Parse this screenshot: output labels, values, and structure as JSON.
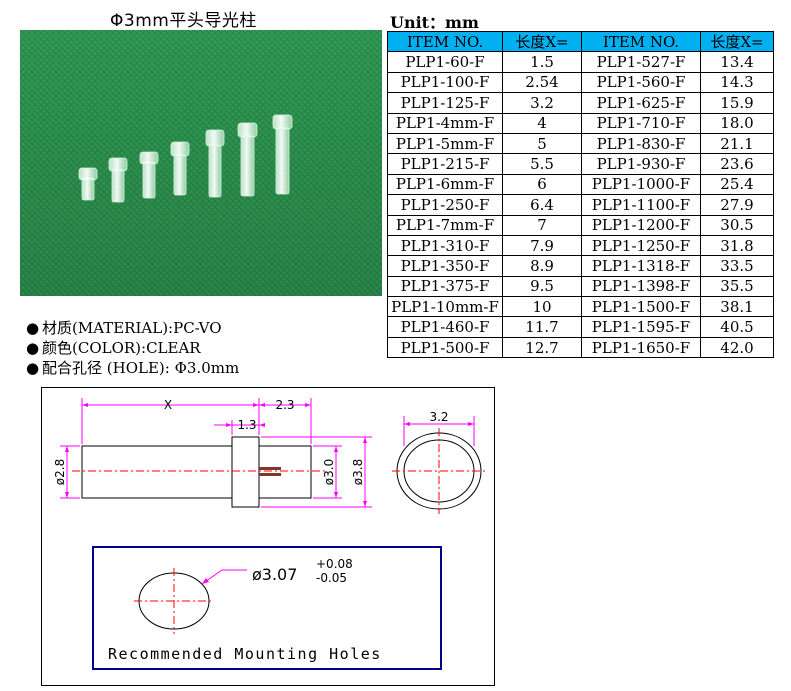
{
  "title": "Φ3mm平头导光柱",
  "unit_label": "Unit：mm",
  "table": {
    "headers": [
      "ITEM NO.",
      "长度X=",
      "ITEM NO.",
      "长度X="
    ],
    "rows": [
      [
        "PLP1-60-F",
        "1.5",
        "PLP1-527-F",
        "13.4"
      ],
      [
        "PLP1-100-F",
        "2.54",
        "PLP1-560-F",
        "14.3"
      ],
      [
        "PLP1-125-F",
        "3.2",
        "PLP1-625-F",
        "15.9"
      ],
      [
        "PLP1-4mm-F",
        "4",
        "PLP1-710-F",
        "18.0"
      ],
      [
        "PLP1-5mm-F",
        "5",
        "PLP1-830-F",
        "21.1"
      ],
      [
        "PLP1-215-F",
        "5.5",
        "PLP1-930-F",
        "23.6"
      ],
      [
        "PLP1-6mm-F",
        "6",
        "PLP1-1000-F",
        "25.4"
      ],
      [
        "PLP1-250-F",
        "6.4",
        "PLP1-1100-F",
        "27.9"
      ],
      [
        "PLP1-7mm-F",
        "7",
        "PLP1-1200-F",
        "30.5"
      ],
      [
        "PLP1-310-F",
        "7.9",
        "PLP1-1250-F",
        "31.8"
      ],
      [
        "PLP1-350-F",
        "8.9",
        "PLP1-1318-F",
        "33.5"
      ],
      [
        "PLP1-375-F",
        "9.5",
        "PLP1-1398-F",
        "35.5"
      ],
      [
        "PLP1-10mm-F",
        "10",
        "PLP1-1500-F",
        "38.1"
      ],
      [
        "PLP1-460-F",
        "11.7",
        "PLP1-1595-F",
        "40.5"
      ],
      [
        "PLP1-500-F",
        "12.7",
        "PLP1-1650-F",
        "42.0"
      ]
    ]
  },
  "properties": {
    "bullet": "●",
    "material": "材质(MATERIAL):PC-VO",
    "color": "颜色(COLOR):CLEAR",
    "hole": "配合孔径 (HOLE): Φ3.0mm"
  },
  "drawing": {
    "dim_x": "X",
    "dim_2_3": "2.3",
    "dim_1_3": "1.3",
    "dim_d2_8": "ø2.8",
    "dim_d3_0": "ø3.0",
    "dim_d3_8": "ø3.8",
    "dim_3_2": "3.2",
    "hole_dia": "ø3.07",
    "hole_tol_plus": "+0.08",
    "hole_tol_minus": "-0.05",
    "holes_label": "Recommended Mounting Holes"
  },
  "colors": {
    "header_bg": "#00b0f0",
    "dim_line": "#ff00ff",
    "center_line": "#ff0000",
    "holes_border": "#00008b",
    "photo_bg": "#2e9a52"
  }
}
